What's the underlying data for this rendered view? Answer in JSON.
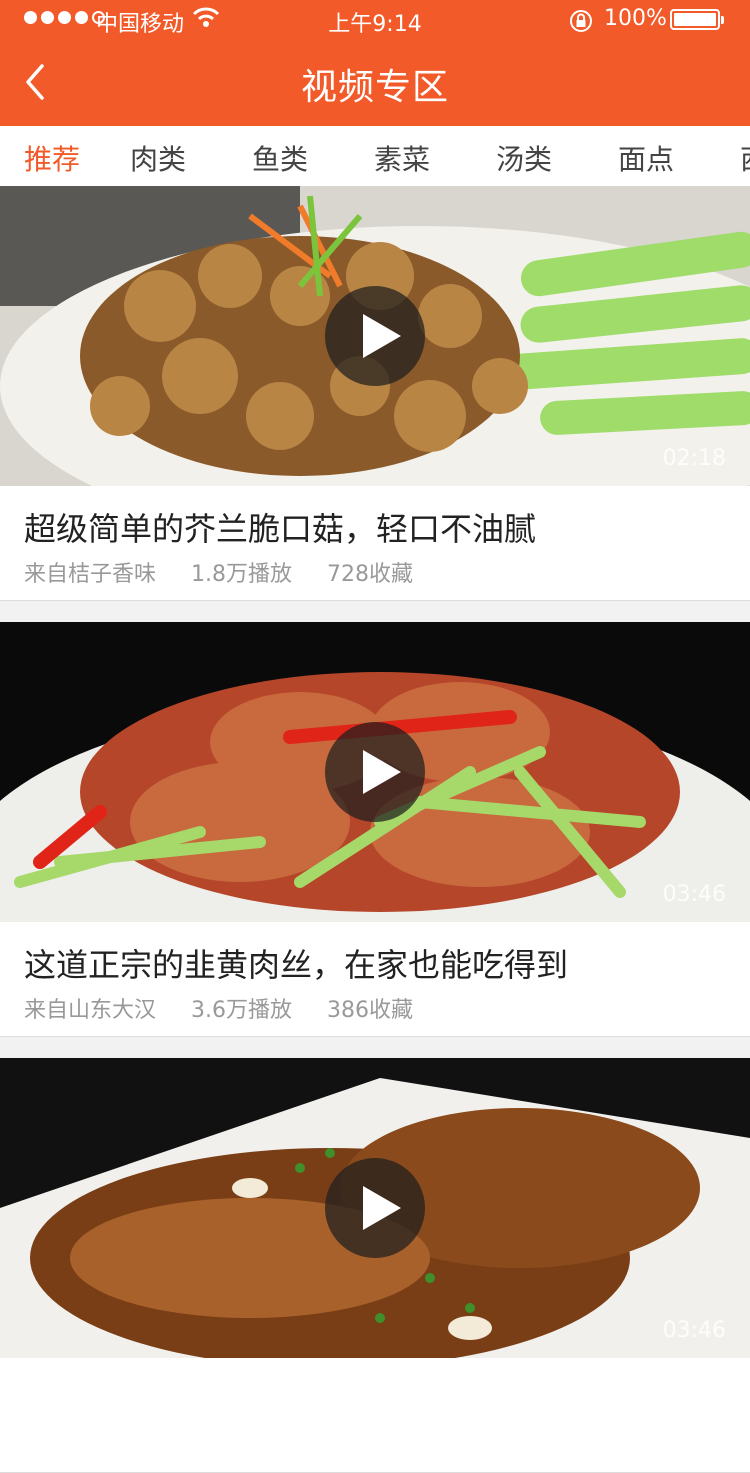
{
  "status_bar": {
    "carrier": "中国移动",
    "time": "上午9:14",
    "battery": "100%"
  },
  "header": {
    "title": "视频专区"
  },
  "tabs": [
    {
      "label": "推荐",
      "active": true
    },
    {
      "label": "肉类",
      "active": false
    },
    {
      "label": "鱼类",
      "active": false
    },
    {
      "label": "素菜",
      "active": false
    },
    {
      "label": "汤类",
      "active": false
    },
    {
      "label": "面点",
      "active": false
    },
    {
      "label": "西",
      "active": false
    }
  ],
  "videos": [
    {
      "title": "超级简单的芥兰脆口菇，轻口不油腻",
      "source": "来自桔子香味",
      "plays": "1.8万播放",
      "favorites": "728收藏",
      "duration": "02:18"
    },
    {
      "title": "这道正宗的韭黄肉丝，在家也能吃得到",
      "source": "来自山东大汉",
      "plays": "3.6万播放",
      "favorites": "386收藏",
      "duration": "03:46"
    },
    {
      "title": "",
      "source": "",
      "plays": "",
      "favorites": "",
      "duration": "03:46"
    }
  ],
  "colors": {
    "accent": "#f25a29",
    "text_primary": "#222222",
    "text_secondary": "#999999"
  }
}
